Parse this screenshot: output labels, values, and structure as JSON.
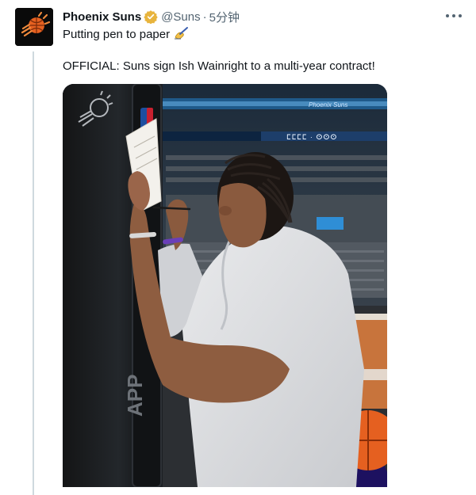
{
  "tweet": {
    "author_name": "Phoenix Suns",
    "handle": "@Suns",
    "separator": "·",
    "time": "5分钟",
    "line1": "Putting pen to paper",
    "line2": "OFFICIAL: Suns sign Ish Wainright to a multi-year contract!"
  },
  "media": {
    "banner_text": "Phoenix Suns",
    "ribbon_text": "ⵎⵎⵎⵎ  ·  ⵙⵙⵙ",
    "sign_text": "APP"
  },
  "colors": {
    "verified": "#e8b43d",
    "suns_orange": "#e56020",
    "suns_purple": "#1d1160"
  }
}
